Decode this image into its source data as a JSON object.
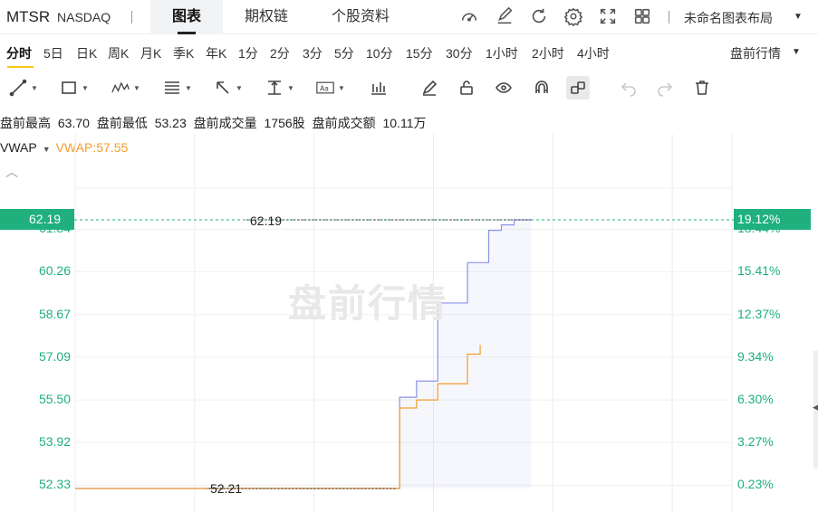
{
  "header": {
    "ticker": "MTSR",
    "exchange": "NASDAQ",
    "tabs": [
      {
        "label": "图表",
        "active": true
      },
      {
        "label": "期权链",
        "active": false
      },
      {
        "label": "个股资料",
        "active": false
      }
    ],
    "layout_name": "未命名图表布局",
    "icons": [
      "gauge-icon",
      "edit-icon",
      "refresh-icon",
      "settings-icon",
      "fullscreen-icon",
      "grid-icon"
    ]
  },
  "periods": {
    "items": [
      "分时",
      "5日",
      "日K",
      "周K",
      "月K",
      "季K",
      "年K",
      "1分",
      "2分",
      "3分",
      "5分",
      "10分",
      "15分",
      "30分",
      "1小时",
      "2小时",
      "4小时"
    ],
    "active": "分时",
    "session_select": "盘前行情"
  },
  "toolbar": {
    "tools": [
      "line-tool-icon",
      "rectangle-tool-icon",
      "pattern-tool-icon",
      "fib-tool-icon",
      "arrow-tool-icon",
      "measure-tool-icon",
      "text-tool-icon",
      "indicator-icon",
      "pen-icon",
      "lock-icon",
      "eye-icon",
      "magnet-icon",
      "link-icon",
      "undo-icon",
      "redo-icon",
      "trash-icon"
    ]
  },
  "stats": {
    "high_label": "盘前最高",
    "high_value": "63.70",
    "low_label": "盘前最低",
    "low_value": "53.23",
    "vol_label": "盘前成交量",
    "vol_value": "1756股",
    "amt_label": "盘前成交额",
    "amt_value": "10.11万"
  },
  "indicator": {
    "name": "VWAP",
    "value_text": "VWAP:57.55"
  },
  "chart": {
    "current_price": "62.19",
    "current_pct": "19.12%",
    "watermark": "盘前行情",
    "high_marker": "62.19",
    "low_marker": "52.21",
    "colors": {
      "up": "#1fb07e",
      "price_line": "#8a94e8",
      "vwap_line": "#f39c2b"
    }
  },
  "chart_data": {
    "type": "line",
    "y_ticks_left": [
      "61.84",
      "60.26",
      "58.67",
      "57.09",
      "55.50",
      "53.92",
      "52.33"
    ],
    "y_ticks_right": [
      "18.44%",
      "15.41%",
      "12.37%",
      "9.34%",
      "6.30%",
      "3.27%",
      "0.23%"
    ],
    "ylim": [
      52.21,
      62.19
    ],
    "grid": true,
    "series": [
      {
        "name": "Price",
        "x": [
          0,
          1,
          2,
          3,
          3.1,
          3.3,
          3.5,
          3.7,
          4.0,
          4.3,
          4.6,
          4.7,
          5.0,
          5.2,
          5.5,
          5.8,
          6.0,
          6.2
        ],
        "values": [
          52.21,
          52.21,
          52.21,
          52.21,
          55.6,
          55.6,
          56.2,
          56.2,
          59.1,
          59.1,
          59.1,
          60.6,
          60.6,
          61.8,
          62.0,
          62.19,
          62.19,
          62.19
        ]
      },
      {
        "name": "VWAP",
        "x": [
          0,
          1,
          2,
          3,
          3.1,
          3.3,
          3.5,
          3.7,
          4.0,
          4.3,
          4.6,
          4.7,
          5.0
        ],
        "values": [
          52.21,
          52.21,
          52.21,
          52.21,
          55.2,
          55.2,
          55.5,
          55.5,
          56.1,
          56.1,
          56.1,
          57.2,
          57.55
        ]
      }
    ]
  }
}
